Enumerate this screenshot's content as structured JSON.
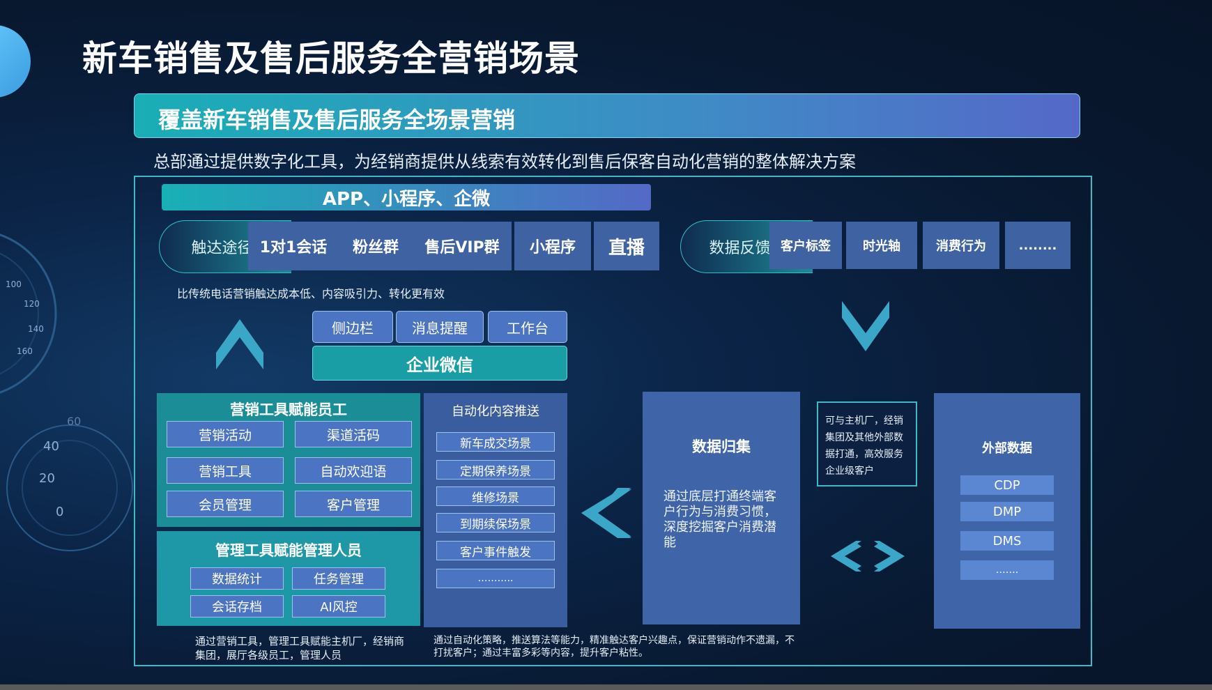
{
  "title": "新车销售及售后服务全营销场景",
  "banner": "覆盖新车销售及售后服务全场景营销",
  "subtitle": "总部通过提供数字化工具，为经销商提供从线索有效转化到售后保客自动化营销的整体解决方案",
  "app_bar": "APP、小程序、企微",
  "touch": {
    "label": "触达途径",
    "items": [
      "1对1会话",
      "粉丝群",
      "售后VIP群",
      "小程序",
      "直播"
    ],
    "note": "比传统电话营销触达成本低、内容吸引力、转化更有效"
  },
  "feedback": {
    "label": "数据反馈",
    "items": [
      "客户标签",
      "时光轴",
      "消费行为",
      "........"
    ]
  },
  "wecom": {
    "buttons": [
      "侧边栏",
      "消息提醒",
      "工作台"
    ],
    "title": "企业微信"
  },
  "marketing_tools": {
    "title": "营销工具赋能员工",
    "items": [
      "营销活动",
      "渠道活码",
      "营销工具",
      "自动欢迎语",
      "会员管理",
      "客户管理"
    ]
  },
  "management_tools": {
    "title": "管理工具赋能管理人员",
    "items": [
      "数据统计",
      "任务管理",
      "会话存档",
      "AI风控"
    ]
  },
  "tools_note": "通过营销工具，管理工具赋能主机厂，经销商集团，展厅各级员工，管理人员",
  "auto_push": {
    "title": "自动化内容推送",
    "items": [
      "新车成交场景",
      "定期保养场景",
      "维修场景",
      "到期续保场景",
      "客户事件触发",
      "……….."
    ],
    "note": "通过自动化策略，推送算法等能力，精准触达客户兴趣点，保证营销动作不遗漏，不打扰客户；通过丰富多彩等内容，提升客户粘性。"
  },
  "data_collect": {
    "title": "数据归集",
    "desc": "通过底层打通终端客户行为与消费习惯，深度挖掘客户消费潜能"
  },
  "connect_note": "可与主机厂，经销集团及其他外部数据打通，高效服务企业级客户",
  "external": {
    "title": "外部数据",
    "items": [
      "CDP",
      "DMP",
      "DMS",
      "……."
    ]
  },
  "gauge": {
    "upper_ticks": [
      "100",
      "120",
      "140",
      "160"
    ],
    "lower_ticks": [
      "60",
      "40",
      "20",
      "0"
    ]
  },
  "colors": {
    "background": "#0b2447",
    "cyan": "#1a8d96",
    "panel_blue": "#3f65a8",
    "pill_blue": "#4b74c2",
    "arrow": "#3aa6c8"
  }
}
